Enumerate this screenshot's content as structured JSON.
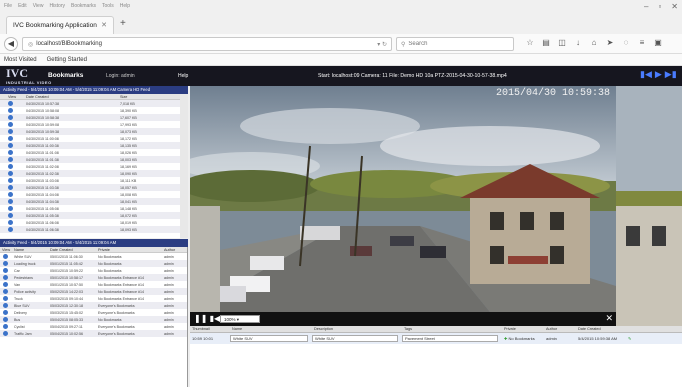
{
  "browser": {
    "menu": [
      "File",
      "Edit",
      "View",
      "History",
      "Bookmarks",
      "Tools",
      "Help"
    ],
    "win_controls": [
      "–",
      "▫",
      "✕"
    ],
    "tab_title": "IVC Bookmarking Application",
    "tab_close": "✕",
    "new_tab": "+",
    "url": "localhost/BlBookmarking",
    "search_placeholder": "Search",
    "bookmarks_bar": [
      "Most Visited",
      "Getting Started"
    ]
  },
  "app": {
    "logo": "IVC",
    "logo_sub": "INDUSTRIAL VIDEO",
    "section": "Bookmarks",
    "user": "Login: admin",
    "help": "Help",
    "status": "Start: localhost:09 Camera: 11 File: Demo HD 10a PTZ-2015-04-30-10-57-38.mp4"
  },
  "left_top": {
    "title": "Activity Feed - 5/4/2015 10:09:04 AM - 5/4/2015 11:09:04 AM Camera HD Feed",
    "columns": [
      "View",
      "Date Created",
      "Size"
    ],
    "rows": [
      {
        "date": "04/30/2015 10:57:38",
        "size": "7,018 KB"
      },
      {
        "date": "04/30/2015 10:58:08",
        "size": "18,390 KB"
      },
      {
        "date": "04/30/2015 10:58:38",
        "size": "17,607 KB"
      },
      {
        "date": "04/30/2015 10:59:08",
        "size": "17,993 KB"
      },
      {
        "date": "04/30/2015 10:59:38",
        "size": "18,073 KB"
      },
      {
        "date": "04/30/2015 11:00:08",
        "size": "18,172 KB"
      },
      {
        "date": "04/30/2015 11:00:38",
        "size": "18,135 KB"
      },
      {
        "date": "04/30/2015 11:01:08",
        "size": "18,026 KB"
      },
      {
        "date": "04/30/2015 11:01:38",
        "size": "18,003 KB"
      },
      {
        "date": "04/30/2015 11:02:08",
        "size": "18,169 KB"
      },
      {
        "date": "04/30/2015 11:02:38",
        "size": "18,090 KB"
      },
      {
        "date": "04/30/2015 11:03:08",
        "size": "18,111 KB"
      },
      {
        "date": "04/30/2015 11:03:38",
        "size": "18,057 KB"
      },
      {
        "date": "04/30/2015 11:04:08",
        "size": "18,008 KB"
      },
      {
        "date": "04/30/2015 11:04:38",
        "size": "18,041 KB"
      },
      {
        "date": "04/30/2015 11:05:08",
        "size": "18,148 KB"
      },
      {
        "date": "04/30/2015 11:05:38",
        "size": "18,072 KB"
      },
      {
        "date": "04/30/2015 11:06:08",
        "size": "18,019 KB"
      },
      {
        "date": "04/30/2015 11:06:38",
        "size": "18,093 KB"
      }
    ]
  },
  "left_bottom": {
    "title": "Activity Feed - 5/4/2015 10:09:04 AM - 5/4/2015 11:09:04 AM",
    "columns": [
      "View",
      "Name",
      "Date Created",
      "Private",
      "Author"
    ],
    "rows": [
      {
        "name": "White SUV",
        "date": "05/01/2015 11:06:30",
        "private": "No Bookmarks",
        "author": "admin"
      },
      {
        "name": "Loading truck",
        "date": "05/01/2015 11:05:42",
        "private": "No Bookmarks",
        "author": "admin"
      },
      {
        "name": "Car",
        "date": "05/01/2015 10:59:22",
        "private": "No Bookmarks",
        "author": "admin"
      },
      {
        "name": "Pedestrians",
        "date": "05/01/2015 10:58:17",
        "private": "No Bookmarks Entrance #14",
        "author": "admin"
      },
      {
        "name": "Van",
        "date": "05/01/2015 10:57:50",
        "private": "No Bookmarks Entrance #14",
        "author": "admin"
      },
      {
        "name": "Police activity",
        "date": "05/02/2015 14:22:03",
        "private": "No Bookmarks Entrance #14",
        "author": "admin"
      },
      {
        "name": "Truck",
        "date": "05/03/2015 09:10:44",
        "private": "No Bookmarks Entrance #14",
        "author": "admin"
      },
      {
        "name": "Blue SUV",
        "date": "05/03/2015 12:30:18",
        "private": "Everyone's Bookmarks",
        "author": "admin"
      },
      {
        "name": "Delivery",
        "date": "05/03/2015 15:45:02",
        "private": "Everyone's Bookmarks",
        "author": "admin"
      },
      {
        "name": "Bus",
        "date": "05/04/2015 08:05:33",
        "private": "No Bookmarks",
        "author": "admin"
      },
      {
        "name": "Cyclist",
        "date": "05/04/2015 09:27:11",
        "private": "Everyone's Bookmarks",
        "author": "admin"
      },
      {
        "name": "Traffic Jam",
        "date": "05/04/2015 10:02:56",
        "private": "Everyone's Bookmarks",
        "author": "admin"
      }
    ]
  },
  "video": {
    "timestamp": "2015/04/30 10:59:38",
    "speed": "100%",
    "play": "❚❚",
    "skip": "▮◀",
    "expand": "✕"
  },
  "bookmark_table": {
    "columns": [
      "Thumbnail",
      "Name",
      "Description",
      "Tags",
      "Private",
      "Author",
      "Date Created"
    ],
    "row": {
      "time": "10:59 10:01",
      "name": "White SUV",
      "description": "White SUV",
      "tags": "Pavement Street",
      "private": "No Bookmarks",
      "author": "admin",
      "date": "5/4/2015 10:59:38 AM"
    }
  }
}
